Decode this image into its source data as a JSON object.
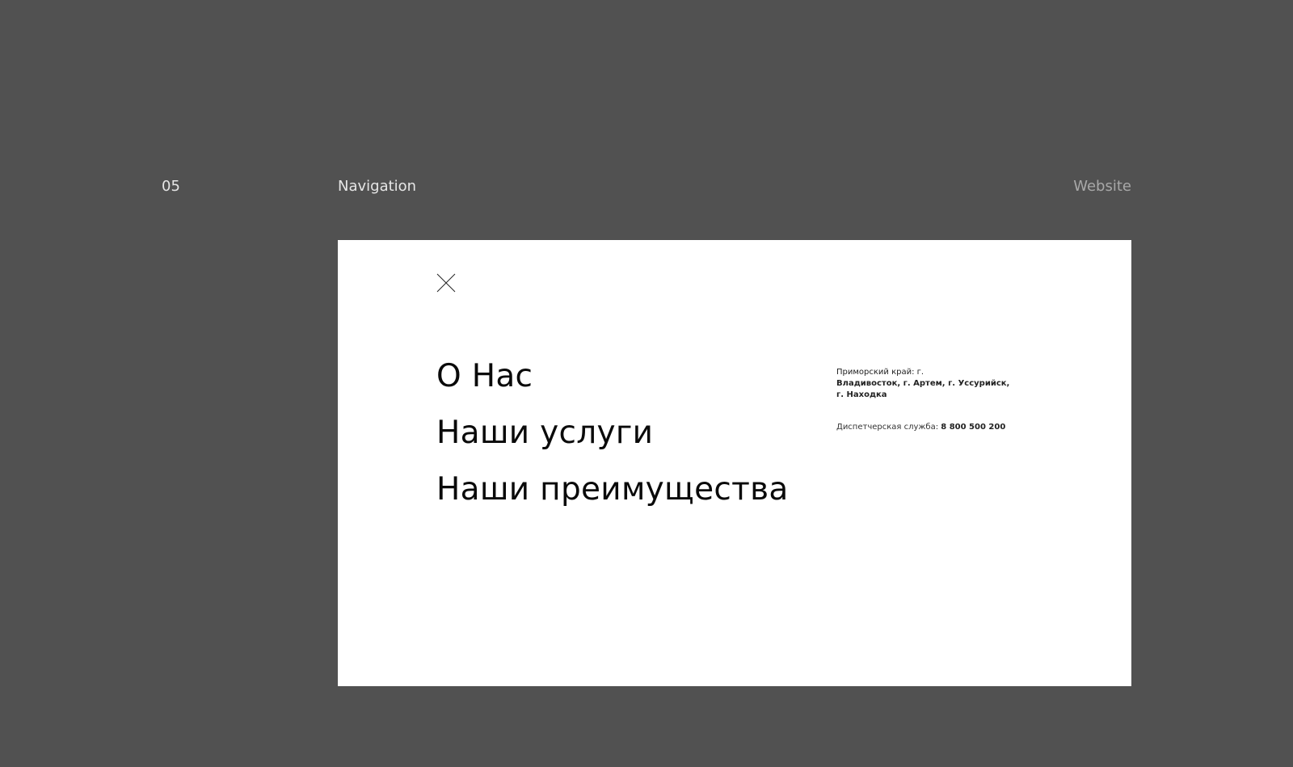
{
  "slide": {
    "number": "05",
    "section": "Navigation",
    "label": "Website"
  },
  "menu": {
    "close_icon": "close-icon",
    "items": [
      {
        "label": "О Нас"
      },
      {
        "label": "Наши услуги"
      },
      {
        "label": "Наши преимущества"
      }
    ]
  },
  "contacts": {
    "region": "Приморский край: г.",
    "cities": "Владивосток, г. Артем,  г. Уссурийск, г. Находка",
    "dispatch_label": "Диспетчерская служба:",
    "phone": "8 800 500 200"
  },
  "colors": {
    "background": "#515151",
    "frame": "#ffffff",
    "text": "#0a0a0a",
    "muted_label": "#a8a8a8"
  }
}
